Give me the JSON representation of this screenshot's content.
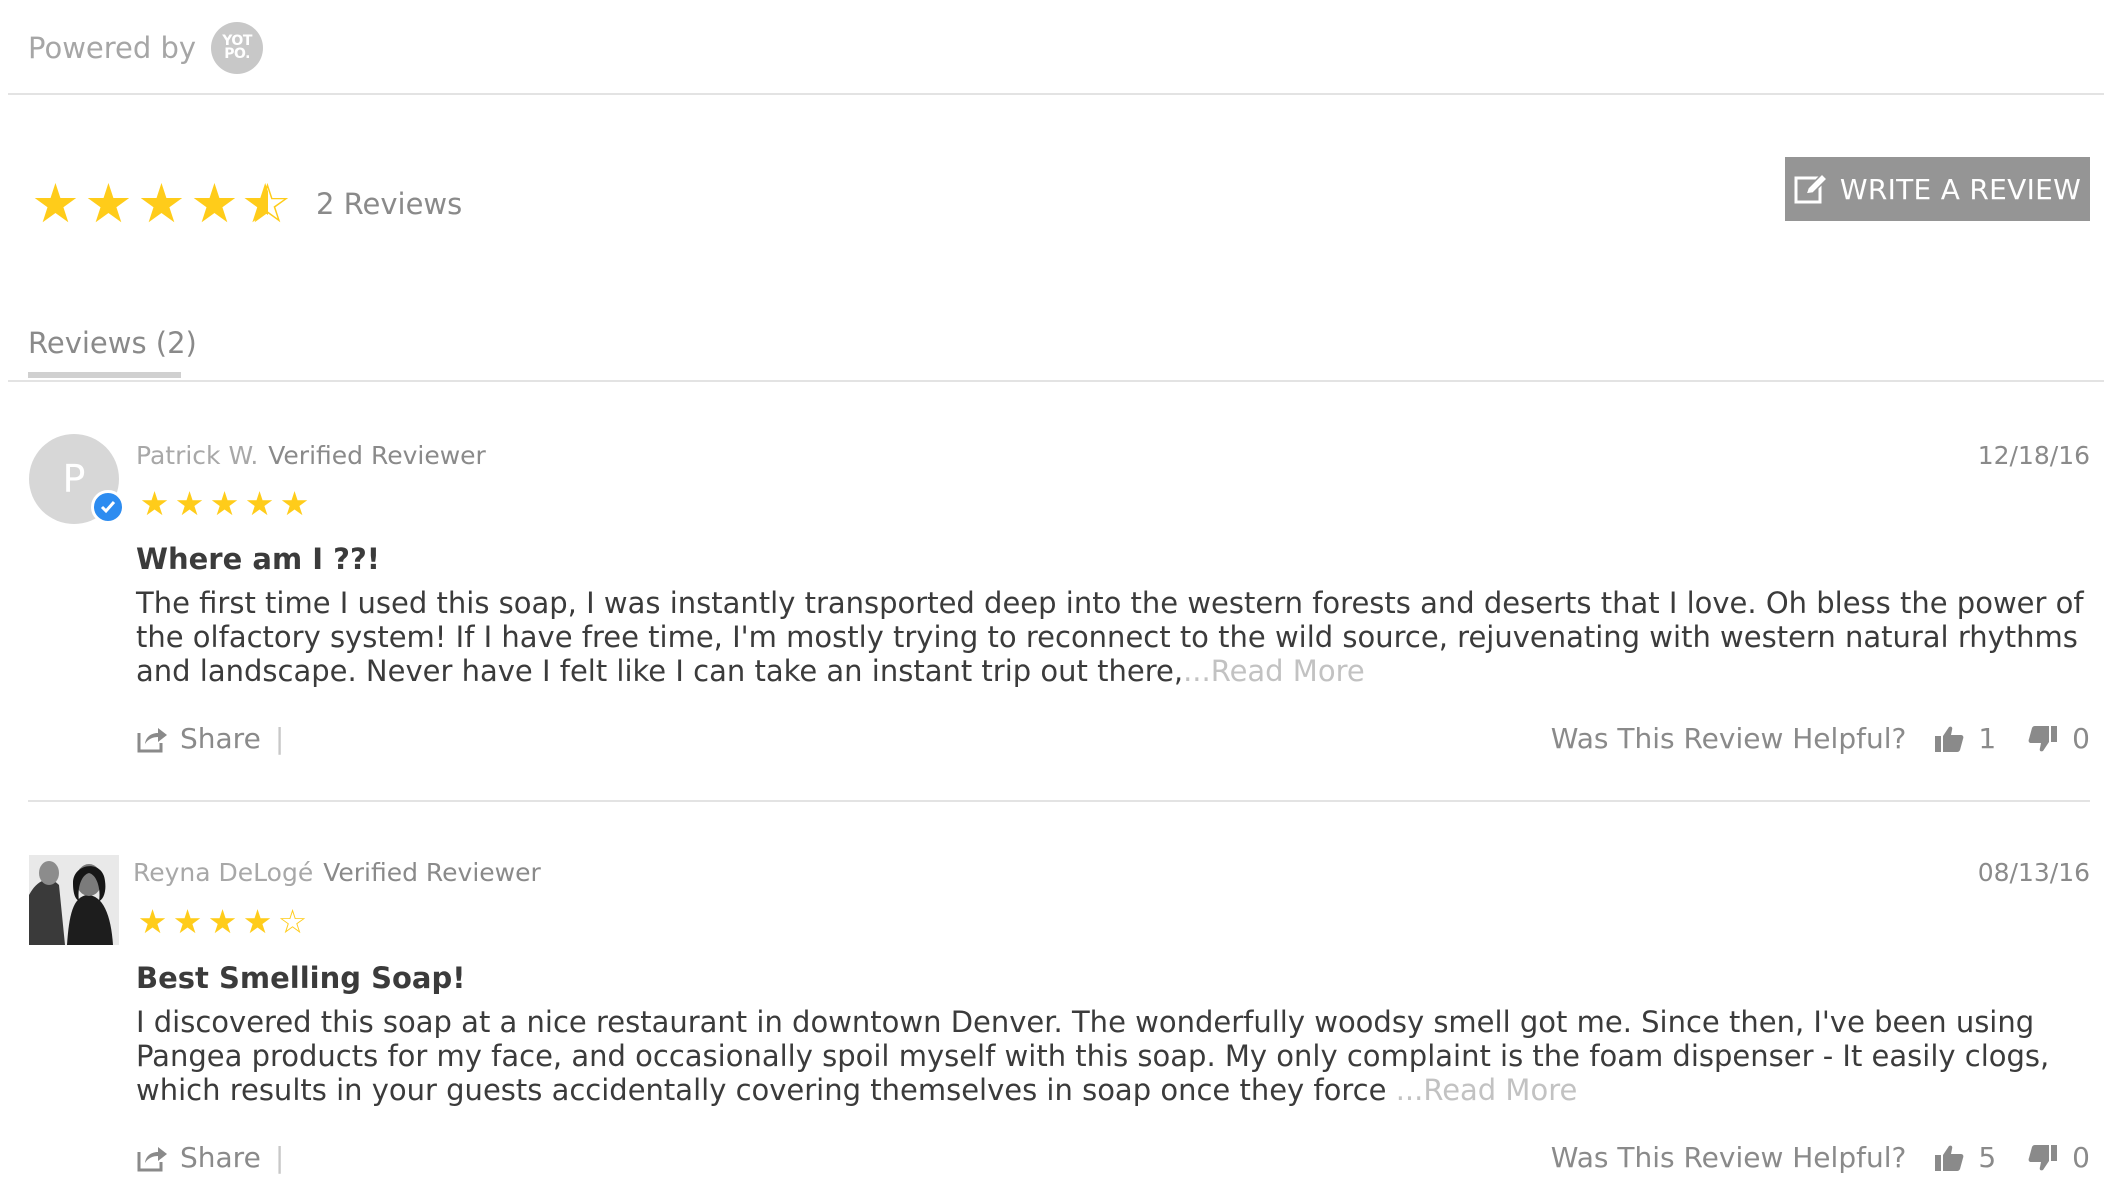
{
  "header": {
    "powered_by": "Powered by",
    "logo_text": "YOT PO."
  },
  "summary": {
    "average_rating": 4.5,
    "max_rating": 5,
    "reviews_count_label": "2 Reviews",
    "star_color": "#ffcc1a"
  },
  "write_review": {
    "label": "WRITE A REVIEW"
  },
  "tabs": [
    {
      "label": "Reviews (2)"
    }
  ],
  "reviews": [
    {
      "avatar_letter": "P",
      "name": "Patrick W.",
      "verified": "Verified Reviewer",
      "date": "12/18/16",
      "rating": 5,
      "title": "Where am I ??!",
      "content": "The first time I used this soap, I was instantly transported deep into the western forests and deserts that I love. Oh bless the power of the olfactory system! If I have free time, I'm mostly trying to reconnect to the wild source, rejuvenating with western natural rhythms and landscape. Never have I felt like I can take an instant trip out there,",
      "read_more": "...Read More",
      "share_label": "Share",
      "separator": "|",
      "helpful_label": "Was This Review Helpful?",
      "votes_up": "1",
      "votes_down": "0"
    },
    {
      "name": "Reyna DeLogé",
      "verified": "Verified Reviewer",
      "date": "08/13/16",
      "rating": 4,
      "title": "Best Smelling Soap!",
      "content": "I discovered this soap at a nice restaurant in downtown Denver. The wonderfully woodsy smell got me. Since then, I've been using Pangea products for my face, and occasionally spoil myself with this soap. My only complaint is the foam dispenser - It easily clogs, which results in your guests accidentally covering themselves in soap once they force ",
      "read_more": "...Read More",
      "share_label": "Share",
      "separator": "|",
      "helpful_label": "Was This Review Helpful?",
      "votes_up": "5",
      "votes_down": "0"
    }
  ]
}
